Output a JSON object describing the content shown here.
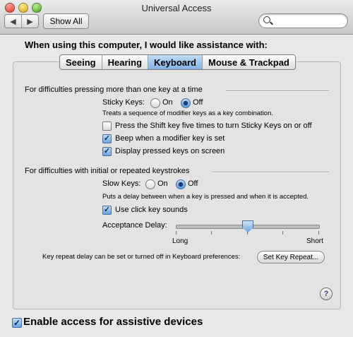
{
  "window": {
    "title": "Universal Access",
    "show_all_label": "Show All",
    "nav_back_icon": "chevron-left-icon",
    "nav_forward_icon": "chevron-right-icon",
    "search_placeholder": ""
  },
  "heading": "When using this computer, I would like assistance with:",
  "tabs": [
    {
      "label": "Seeing",
      "selected": false
    },
    {
      "label": "Hearing",
      "selected": false
    },
    {
      "label": "Keyboard",
      "selected": true
    },
    {
      "label": "Mouse & Trackpad",
      "selected": false
    }
  ],
  "sticky": {
    "section_title": "For difficulties pressing more than one key at a time",
    "label": "Sticky Keys:",
    "on_label": "On",
    "off_label": "Off",
    "selected": "Off",
    "description": "Treats a sequence of modifier keys as a key combination.",
    "options": [
      {
        "label": "Press the Shift key five times to turn Sticky Keys on or off",
        "checked": false
      },
      {
        "label": "Beep when a modifier key is set",
        "checked": true
      },
      {
        "label": "Display pressed keys on screen",
        "checked": true
      }
    ]
  },
  "slow": {
    "section_title": "For difficulties with initial or repeated keystrokes",
    "label": "Slow Keys:",
    "on_label": "On",
    "off_label": "Off",
    "selected": "Off",
    "description": "Puts a delay between when a key is pressed and when it is accepted.",
    "click_sounds_label": "Use click key sounds",
    "click_sounds_checked": true,
    "acceptance_delay_label": "Acceptance Delay:",
    "slider_min_label": "Long",
    "slider_max_label": "Short",
    "slider_value_fraction": 0.5,
    "slider_ticks": 5
  },
  "key_repeat": {
    "text": "Key repeat delay can be set or turned off in Keyboard preferences:",
    "button_label": "Set Key Repeat..."
  },
  "help_label": "?",
  "assistive": {
    "label": "Enable access for assistive devices",
    "checked": true
  },
  "colors": {
    "accent": "#6aa5e2",
    "help_mark": "#5b2a99"
  }
}
